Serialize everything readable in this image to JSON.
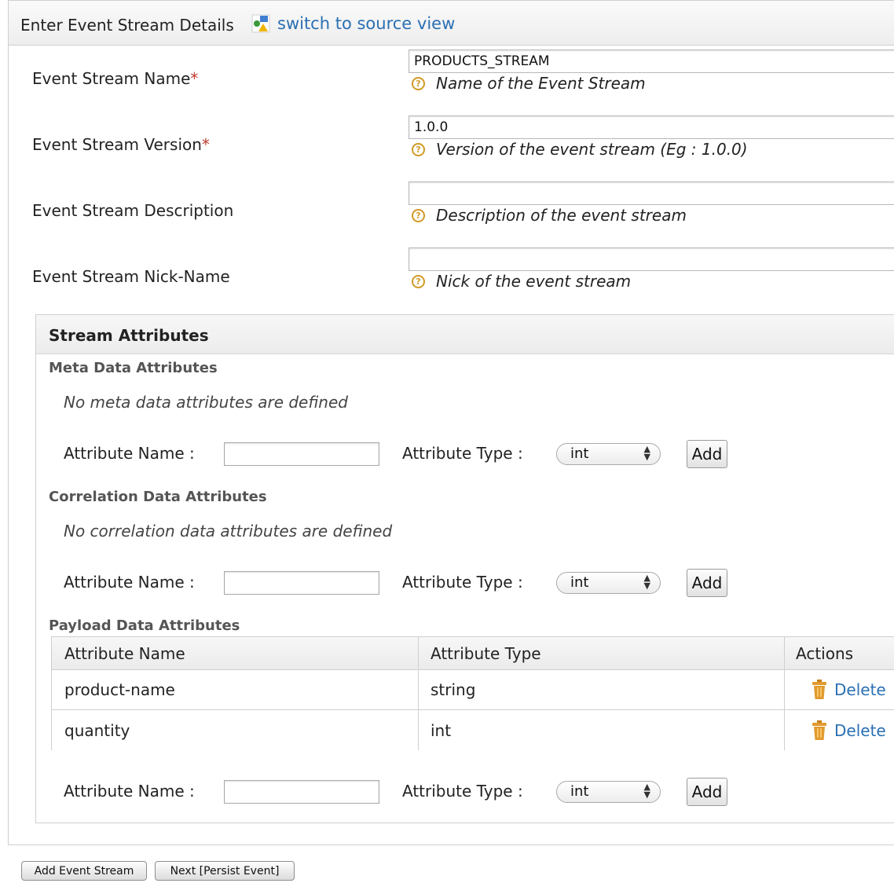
{
  "header": {
    "title": "Enter Event Stream Details",
    "source_view_link": "switch to source view"
  },
  "form": {
    "name": {
      "label": "Event Stream Name",
      "required_mark": "*",
      "value": "PRODUCTS_STREAM",
      "help": "Name of the Event Stream"
    },
    "version": {
      "label": "Event Stream Version",
      "required_mark": "*",
      "value": "1.0.0",
      "help": "Version of the event stream (Eg : 1.0.0)"
    },
    "description": {
      "label": "Event Stream Description",
      "value": "",
      "help": "Description of the event stream"
    },
    "nickname": {
      "label": "Event Stream Nick-Name",
      "value": "",
      "help": "Nick of the event stream"
    }
  },
  "stream_attributes": {
    "title": "Stream Attributes",
    "meta": {
      "title": "Meta Data Attributes",
      "empty_message": "No meta data attributes are defined",
      "name_label": "Attribute Name :",
      "type_label": "Attribute Type :",
      "type_selected": "int",
      "add_label": "Add"
    },
    "correlation": {
      "title": "Correlation Data Attributes",
      "empty_message": "No correlation data attributes are defined",
      "name_label": "Attribute Name :",
      "type_label": "Attribute Type :",
      "type_selected": "int",
      "add_label": "Add"
    },
    "payload": {
      "title": "Payload Data Attributes",
      "columns": [
        "Attribute Name",
        "Attribute Type",
        "Actions"
      ],
      "rows": [
        {
          "name": "product-name",
          "type": "string",
          "action": "Delete"
        },
        {
          "name": "quantity",
          "type": "int",
          "action": "Delete"
        }
      ],
      "name_label": "Attribute Name :",
      "type_label": "Attribute Type :",
      "type_selected": "int",
      "add_label": "Add"
    }
  },
  "footer": {
    "add_stream_label": "Add Event Stream",
    "next_label": "Next [Persist Event]"
  },
  "colors": {
    "link": "#2a6fb2",
    "required": "#c0392b",
    "help_icon": "#d29a26",
    "trash_icon": "#e09a2e"
  }
}
